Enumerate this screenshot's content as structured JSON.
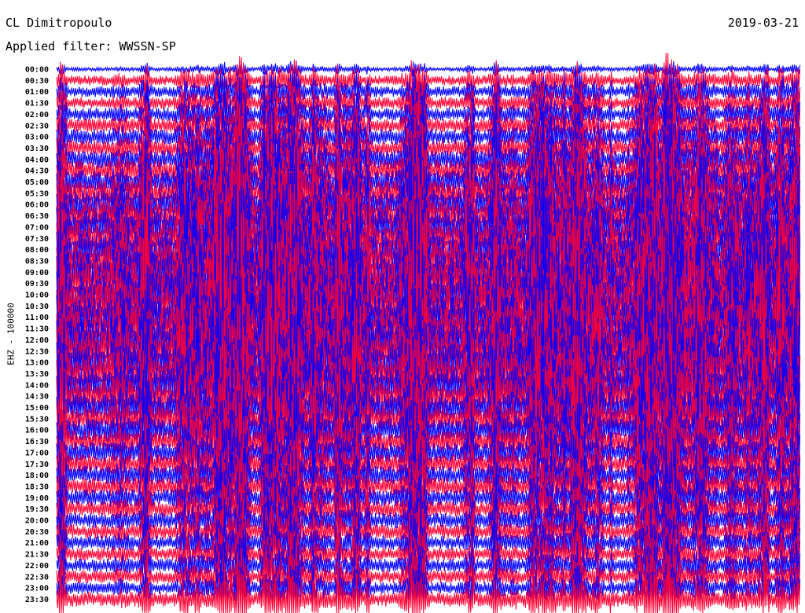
{
  "header": {
    "station": "CL Dimitropoulo",
    "filter": "Applied filter: WWSSN-SP",
    "date": "2019-03-21"
  },
  "channel_label": "EHZ - 100000",
  "colors": {
    "trace_a": "#0000ff",
    "trace_b": "#ff0033",
    "background": "#ffffff"
  },
  "chart_data": {
    "type": "line",
    "title": "CL Dimitropoulo",
    "subtitle": "Applied filter: WWSSN-SP",
    "date": "2019-03-21",
    "ylabel": "EHZ - 100000",
    "row_labels": [
      "00:00",
      "00:30",
      "01:00",
      "01:30",
      "02:00",
      "02:30",
      "03:00",
      "03:30",
      "04:00",
      "04:30",
      "05:00",
      "05:30",
      "06:00",
      "06:30",
      "07:00",
      "07:30",
      "08:00",
      "08:30",
      "09:00",
      "09:30",
      "10:00",
      "10:30",
      "11:00",
      "11:30",
      "12:00",
      "12:30",
      "13:00",
      "13:30",
      "14:00",
      "14:30",
      "15:00",
      "15:30",
      "16:00",
      "16:30",
      "17:00",
      "17:30",
      "18:00",
      "18:30",
      "19:00",
      "19:30",
      "20:00",
      "20:30",
      "21:00",
      "21:30",
      "22:00",
      "22:30",
      "23:00",
      "23:30"
    ],
    "series": [
      {
        "color": "#0000ff",
        "rows": "even"
      },
      {
        "color": "#ff0033",
        "rows": "odd"
      }
    ],
    "relative_amplitude": [
      0.3,
      0.8,
      0.9,
      1.0,
      1.1,
      1.2,
      1.3,
      1.4,
      1.6,
      1.8,
      2.0,
      2.2,
      2.4,
      2.6,
      2.7,
      2.8,
      3.0,
      3.2,
      3.4,
      3.5,
      3.6,
      3.6,
      3.5,
      3.5,
      3.4,
      3.3,
      3.2,
      3.0,
      2.8,
      2.6,
      2.3,
      2.1,
      1.9,
      1.8,
      1.7,
      1.6,
      1.5,
      1.5,
      1.4,
      1.3,
      1.3,
      1.2,
      1.2,
      1.1,
      1.1,
      1.1,
      1.0,
      1.2
    ],
    "grid": false
  }
}
